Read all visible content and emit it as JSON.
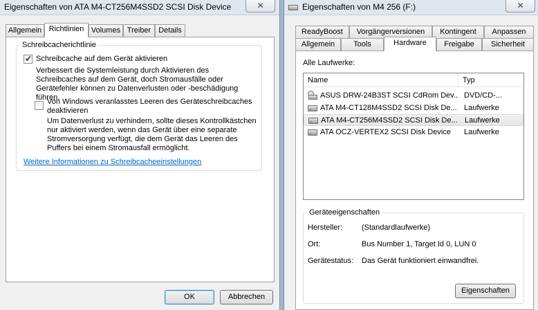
{
  "left_window": {
    "title": "Eigenschaften von ATA M4-CT256M4SSD2 SCSI Disk Device",
    "tabs": [
      "Allgemein",
      "Richtlinien",
      "Volumes",
      "Treiber",
      "Details"
    ],
    "active_tab": "Richtlinien",
    "group_title": "Schreibcacherichtlinie",
    "checkbox1": {
      "label": "Schreibcache auf dem Gerät aktivieren",
      "checked": true,
      "description": "Verbessert die Systemleistung durch Aktivieren des Schreibcaches auf dem Gerät, doch Stromausfälle oder Gerätefehler können zu Datenverlusten oder -beschädigung führen."
    },
    "checkbox2": {
      "label": "Von Windows veranlasstes Leeren des Geräteschreibcaches deaktivieren",
      "checked": false,
      "description": "Um Datenverlust zu verhindern, sollte dieses Kontrollkästchen nur aktiviert werden, wenn das Gerät über eine separate Stromversorgung verfügt, die dem Gerät das Leeren des Puffers bei einem Stromausfall ermöglicht."
    },
    "link": "Weitere Informationen zu Schreibcacheeinstellungen",
    "ok_button": "OK",
    "cancel_button": "Abbrechen"
  },
  "right_window": {
    "title": "Eigenschaften von M4 256 (F:)",
    "tabs_row1": [
      "ReadyBoost",
      "Vorgängerversionen",
      "Kontingent",
      "Anpassen"
    ],
    "tabs_row2": [
      "Allgemein",
      "Tools",
      "Hardware",
      "Freigabe",
      "Sicherheit"
    ],
    "active_tab": "Hardware",
    "drives_label": "Alle Laufwerke:",
    "columns": {
      "name": "Name",
      "type": "Typ"
    },
    "drives": [
      {
        "name": "ASUS DRW-24B3ST SCSI CdRom Dev...",
        "type": "DVD/CD-...",
        "icon": "cdrom-icon",
        "selected": false
      },
      {
        "name": "ATA M4-CT128M4SSD2 SCSI Disk De...",
        "type": "Laufwerke",
        "icon": "disk-drive-icon",
        "selected": false
      },
      {
        "name": "ATA M4-CT256M4SSD2 SCSI Disk De...",
        "type": "Laufwerke",
        "icon": "disk-drive-icon",
        "selected": true
      },
      {
        "name": "ATA OCZ-VERTEX2 SCSI Disk Device",
        "type": "Laufwerke",
        "icon": "disk-drive-icon",
        "selected": false
      }
    ],
    "properties_group": "Geräteeigenschaften",
    "properties": {
      "manufacturer_label": "Hersteller:",
      "manufacturer_value": "(Standardlaufwerke)",
      "location_label": "Ort:",
      "location_value": "Bus Number 1, Target Id 0, LUN 0",
      "status_label": "Gerätestatus:",
      "status_value": "Das Gerät funktioniert einwandfrei."
    },
    "properties_button": "Eigenschaften"
  },
  "colors": {
    "link": "#0066cc",
    "background": "#f0f0f0"
  }
}
